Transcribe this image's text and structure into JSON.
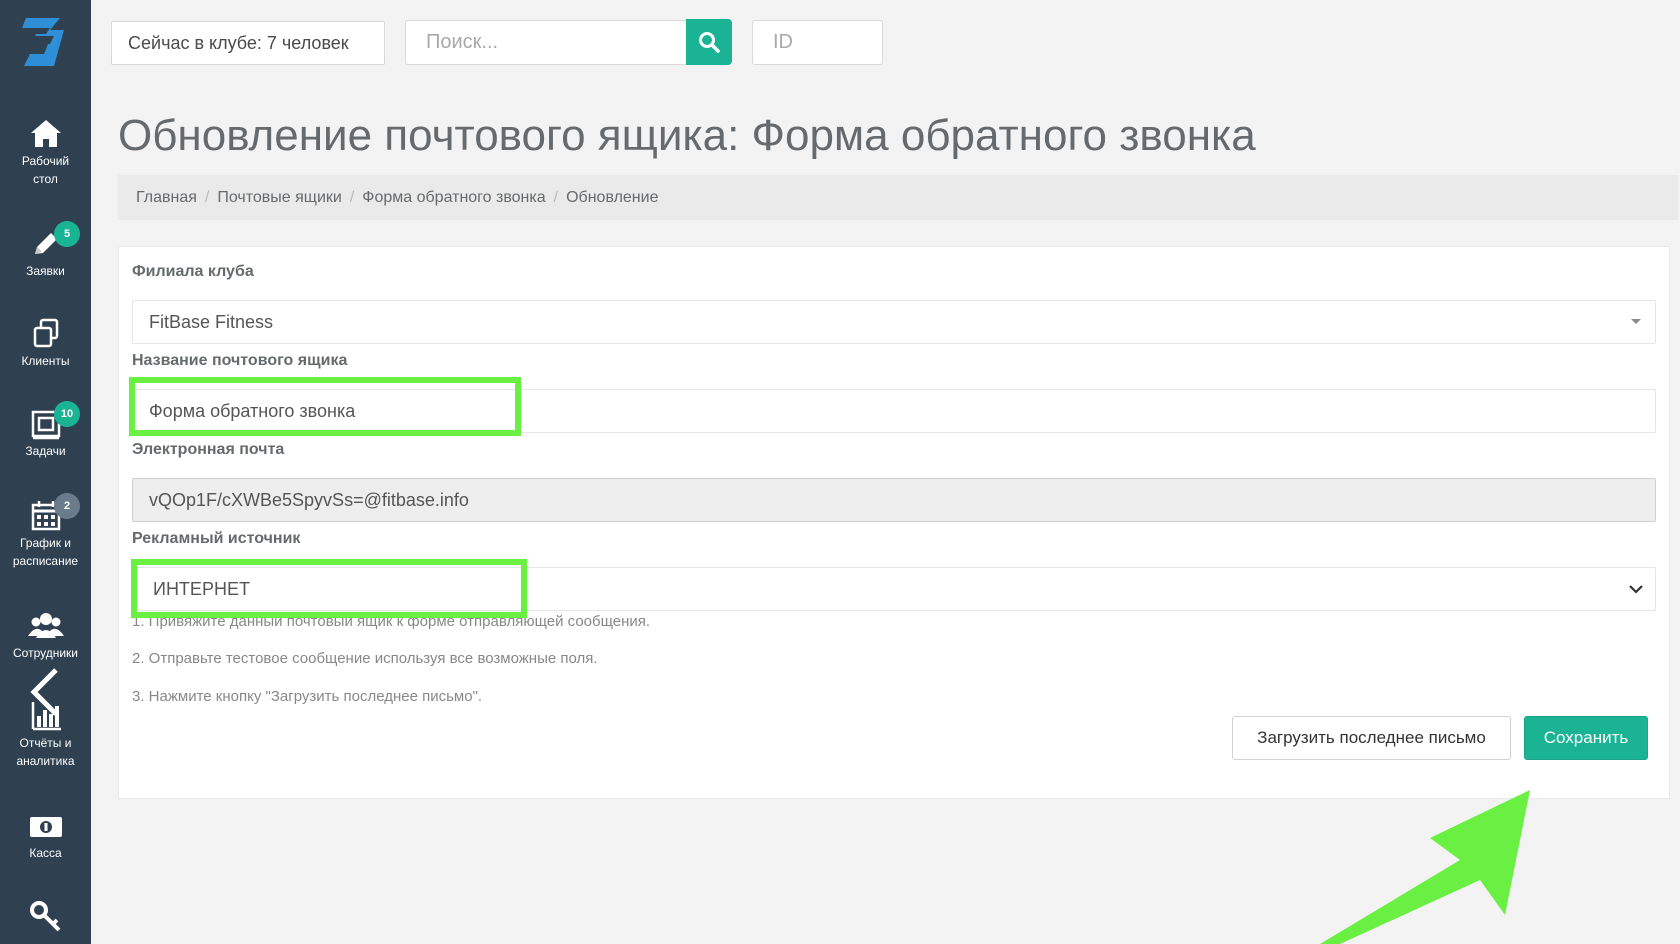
{
  "sidebar": {
    "items": [
      {
        "icon": "home-icon",
        "label_1": "Рабочий",
        "label_2": "стол"
      },
      {
        "icon": "pencil-icon",
        "label_1": "Заявки",
        "label_2": "",
        "badge": "5"
      },
      {
        "icon": "clients-icon",
        "label_1": "Клиенты",
        "label_2": ""
      },
      {
        "icon": "tasks-icon",
        "label_1": "Задачи",
        "label_2": "",
        "badge": "10"
      },
      {
        "icon": "calendar-icon",
        "label_1": "График и",
        "label_2": "расписание",
        "badge": "2"
      },
      {
        "icon": "users-icon",
        "label_1": "Сотрудники",
        "label_2": ""
      },
      {
        "icon": "bar-chart-icon",
        "label_1": "Отчёты и",
        "label_2": "аналитика"
      },
      {
        "icon": "cash-icon",
        "label_1": "Касса",
        "label_2": ""
      },
      {
        "icon": "key-icon",
        "label_1": "",
        "label_2": ""
      }
    ]
  },
  "topbar": {
    "club_status": "Сейчас в клубе: 7 человек",
    "search_placeholder": "Поиск...",
    "id_placeholder": "ID"
  },
  "page": {
    "title": "Обновление почтового ящика: Форма обратного звонка"
  },
  "breadcrumb": [
    "Главная",
    "Почтовые ящики",
    "Форма обратного звонка",
    "Обновление"
  ],
  "form": {
    "branch_label": "Филиала клуба",
    "branch_value": "FitBase Fitness",
    "mailbox_name_label": "Название почтового ящика",
    "mailbox_name_value": "Форма обратного звонка",
    "email_label": "Электронная почта",
    "email_value": "vQOp1F/cXWBe5SpyvSs=@fitbase.info",
    "ad_source_label": "Рекламный источник",
    "ad_source_value": "ИНТЕРНЕТ",
    "hints": [
      "1. Привяжите данный почтовый ящик к форме отправляющей сообщения.",
      "2. Отправьте тестовое сообщение используя все возможные поля.",
      "3. Нажмите кнопку \"Загрузить последнее письмо\"."
    ],
    "load_button": "Загрузить последнее письмо",
    "save_button": "Сохранить"
  },
  "colors": {
    "sidebar": "#2f4050",
    "accent": "#1ab394",
    "highlight": "#69f043"
  }
}
